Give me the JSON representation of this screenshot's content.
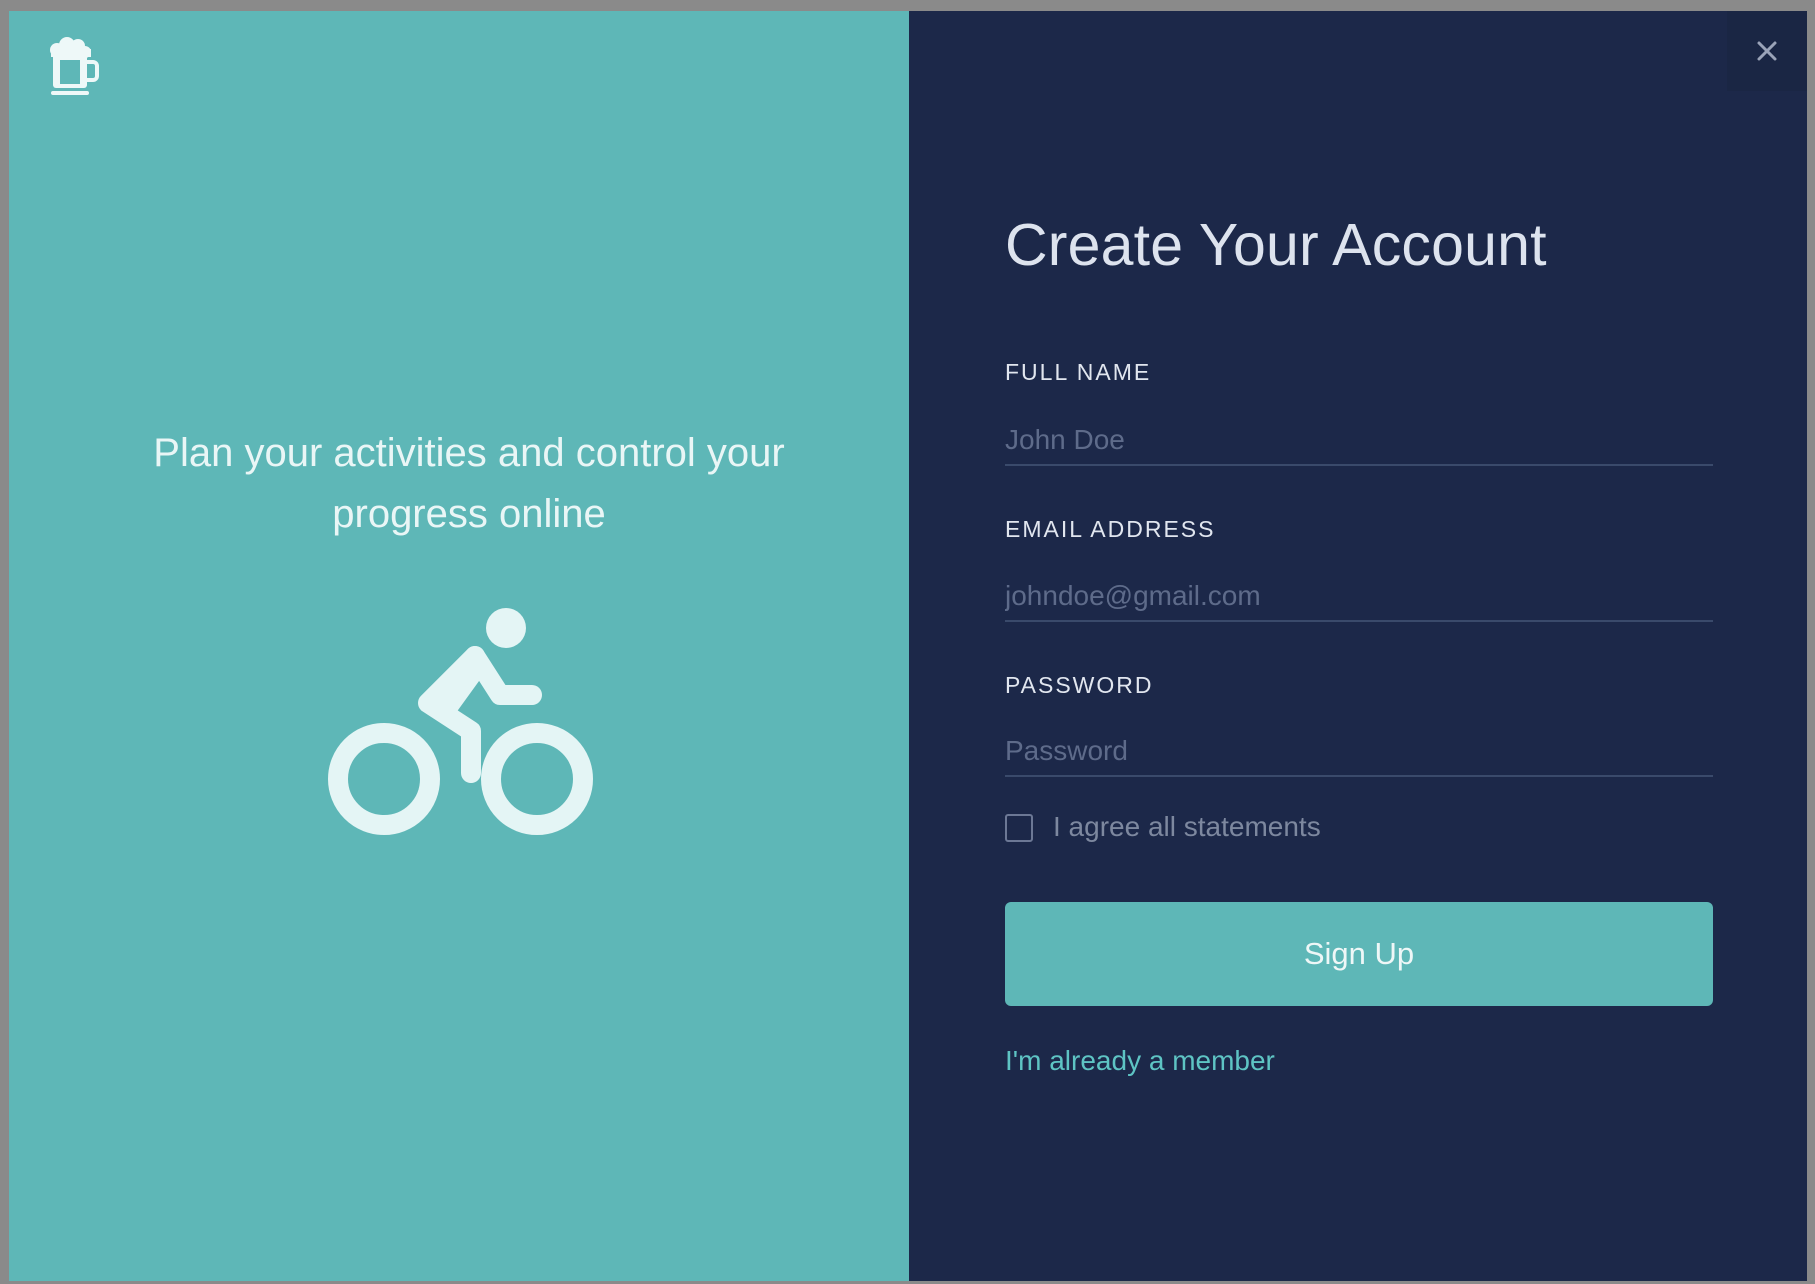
{
  "left_panel": {
    "logo_icon": "beer-mug-icon",
    "tagline": "Plan your activities and control your progress online",
    "illustration_icon": "bicycle-rider-icon"
  },
  "right_panel": {
    "close_icon": "close-icon",
    "title": "Create Your Account",
    "fields": {
      "full_name": {
        "label": "FULL NAME",
        "placeholder": "John Doe",
        "value": ""
      },
      "email": {
        "label": "EMAIL ADDRESS",
        "placeholder": "johndoe@gmail.com",
        "value": ""
      },
      "password": {
        "label": "PASSWORD",
        "placeholder": "Password",
        "value": ""
      }
    },
    "agree": {
      "label": "I agree all statements",
      "checked": false
    },
    "signup_label": "Sign Up",
    "member_link": "I'm already a member"
  },
  "colors": {
    "accent_teal": "#5eb7b7",
    "panel_navy": "#1c2849",
    "link_teal": "#5ec4c4"
  }
}
